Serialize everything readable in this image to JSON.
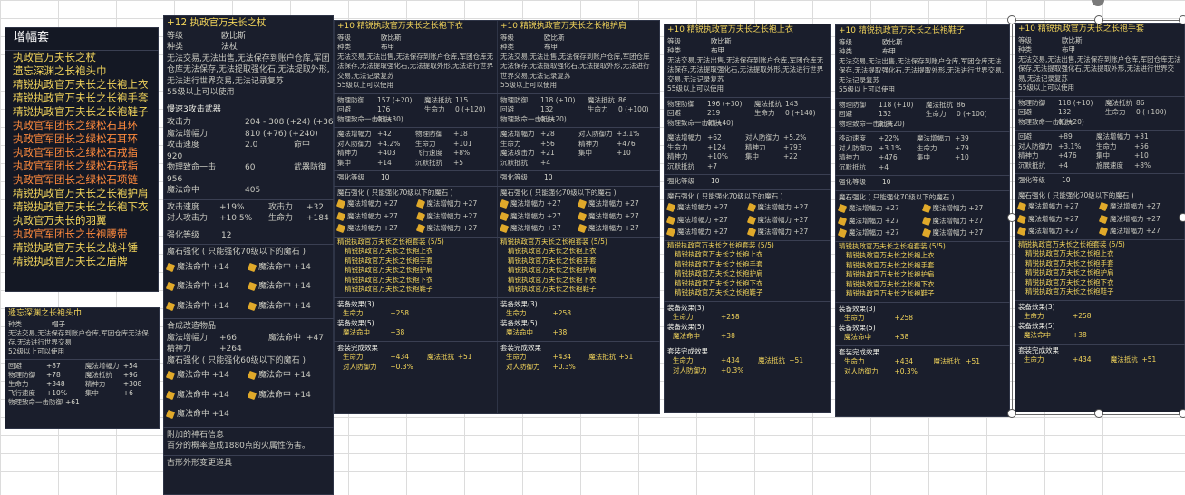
{
  "set_list": {
    "header": "增幅套",
    "items": [
      {
        "t": "执政官万夫长之杖",
        "c": "y"
      },
      {
        "t": "遗忘深渊之长袍头巾",
        "c": "y"
      },
      {
        "t": "精锐执政官万夫长之长袍上衣",
        "c": "y"
      },
      {
        "t": "精锐执政官万夫长之长袍手套",
        "c": "y"
      },
      {
        "t": "精锐执政官万夫长之长袍鞋子",
        "c": "y"
      },
      {
        "t": "执政官军团长之绿松石耳环",
        "c": "o"
      },
      {
        "t": "执政官军团长之绿松石耳环",
        "c": "o"
      },
      {
        "t": "执政官军团长之绿松石戒指",
        "c": "o"
      },
      {
        "t": "执政官军团长之绿松石戒指",
        "c": "o"
      },
      {
        "t": "执政官军团长之绿松石项链",
        "c": "o"
      },
      {
        "t": "精锐执政官万夫长之长袍护肩",
        "c": "y"
      },
      {
        "t": "精锐执政官万夫长之长袍下衣",
        "c": "y"
      },
      {
        "t": "执政官万夫长的羽翼",
        "c": "y"
      },
      {
        "t": "执政官军团长之长袍腰带",
        "c": "o"
      },
      {
        "t": "精锐执政官万夫长之战斗锤",
        "c": "y"
      },
      {
        "t": "精锐执政官万夫长之盾牌",
        "c": "y"
      }
    ]
  },
  "headpiece": {
    "title": "遗忘深渊之长袍头巾",
    "type_label": "种类",
    "type_value": "帽子",
    "desc": "无法交易,无法保存到账户仓库,军团仓库无法保存,无法进行世界交易",
    "level": "52级以上可以使用",
    "stats": [
      [
        "回避",
        "+87",
        "魔法增幅力",
        "+54"
      ],
      [
        "物理防御",
        "+78",
        "魔法抵抗",
        "+96"
      ],
      [
        "生命力",
        "+348",
        "精神力",
        "+308"
      ],
      [
        "飞行速度",
        "+10%",
        "集中",
        "+6"
      ],
      [
        "物理致命一击防御",
        "+61",
        "",
        ""
      ]
    ]
  },
  "staff": {
    "title": "+12 执政官万夫长之杖",
    "grade_label": "等级",
    "grade_value": "欧比斯",
    "type_label": "种类",
    "type_value": "法杖",
    "desc": "无法交易,无法出售,无法保存到账户仓库,军团仓库无法保存,无法提取强化石,无法提取外形,无法进行世界交易,无法记录复苏",
    "level": "55级以上可以使用",
    "weapon_hdr": "慢速3攻击武器",
    "base": [
      [
        "攻击力",
        "204 - 308 (+24) (+36)"
      ],
      [
        "魔法增幅力",
        "810 (+76) (+240)"
      ],
      [
        "攻击速度",
        "2.0",
        "命中",
        "920"
      ],
      [
        "物理致命一击",
        "60",
        "武器防御",
        "956"
      ],
      [
        "魔法命中",
        "405"
      ]
    ],
    "bonus": [
      [
        "攻击速度",
        "+19%",
        "攻击力",
        "+32"
      ],
      [
        "对人攻击力",
        "+10.5%",
        "生命力",
        "+184"
      ]
    ],
    "enh_label": "强化等级",
    "enh_value": "12",
    "gem_hdr1": "魔石强化 ( 只能强化70级以下的魔石 )",
    "gems1": [
      "魔法命中 +14",
      "魔法命中 +14",
      "魔法命中 +14",
      "魔法命中 +14",
      "魔法命中 +14",
      "魔法命中 +14"
    ],
    "combine_hdr": "合成改造物品",
    "combine": [
      [
        "魔法增幅力",
        "+66",
        "魔法命中",
        "+47"
      ],
      [
        "精神力",
        "+264",
        "",
        ""
      ]
    ],
    "gem_hdr2": "魔石强化 ( 只能强化60级以下的魔石 )",
    "gems2": [
      "魔法命中 +14",
      "魔法命中 +14",
      "魔法命中 +14",
      "魔法命中 +14",
      "魔法命中 +14"
    ],
    "extra_hdr": "附加的神石信息",
    "extra": "百分的概率造成1880点的火属性伤害。",
    "footer": "古形外形变更道具"
  },
  "panels": [
    {
      "id": "pants",
      "title": "+10 精锐执政官万夫长之长袍下衣",
      "grade": "欧比斯",
      "type": "布甲",
      "desc": "无法交易,无法出售,无法保存到账户仓库,军团仓库无法保存,无法提取强化石,无法提取外形,无法进行世界交易,无法记录复苏",
      "level": "55级以上可以使用",
      "base": [
        [
          "物理防御",
          "157 (+20)",
          "魔法抵抗",
          "115"
        ],
        [
          "回避",
          "176",
          "生命力",
          "0 (+120)"
        ],
        [
          "物理致命一击抵抗",
          "0 (+30)",
          "",
          ""
        ]
      ],
      "bonus": [
        [
          "魔法增幅力",
          "+42",
          "物理防御",
          "+18"
        ],
        [
          "对人防御力",
          "+4.2%",
          "生命力",
          "+101"
        ],
        [
          "精神力",
          "+403",
          "飞行速度",
          "+8%"
        ],
        [
          "集中",
          "+14",
          "沉默抵抗",
          "+5"
        ]
      ],
      "enh": "10",
      "gem_hdr": "魔石强化 ( 只能强化70级以下的魔石 )",
      "gems": [
        "魔法增幅力 +27",
        "魔法增幅力 +27",
        "魔法增幅力 +27",
        "魔法增幅力 +27",
        "魔法增幅力 +27",
        "魔法增幅力 +27"
      ],
      "set_hdr": "精锐执政官万夫长之长袍套装 (5/5)",
      "set_items": [
        "精锐执政官万夫长之长袍上衣",
        "精锐执政官万夫长之长袍手套",
        "精锐执政官万夫长之长袍护肩",
        "精锐执政官万夫长之长袍下衣",
        "精锐执政官万夫长之长袍鞋子"
      ],
      "effects": [
        {
          "h": "装备效果(3)",
          "rows": [
            [
              "生命力",
              "+258",
              "",
              ""
            ]
          ]
        },
        {
          "h": "装备效果(5)",
          "rows": [
            [
              "魔法命中",
              "+38",
              "",
              ""
            ]
          ]
        },
        {
          "h": "套装完成效果",
          "rows": [
            [
              "生命力",
              "+434",
              "魔法抵抗",
              "+51"
            ],
            [
              "对人防御力",
              "+0.3%",
              "",
              ""
            ]
          ]
        }
      ]
    },
    {
      "id": "shoulder",
      "title": "+10 精锐执政官万夫长之长袍护肩",
      "grade": "欧比斯",
      "type": "布甲",
      "desc": "无法交易,无法出售,无法保存到账户仓库,军团仓库无法保存,无法提取强化石,无法提取外形,无法进行世界交易,无法记录复苏",
      "level": "55级以上可以使用",
      "base": [
        [
          "物理防御",
          "118 (+10)",
          "魔法抵抗",
          "86"
        ],
        [
          "回避",
          "132",
          "生命力",
          "0 (+100)"
        ],
        [
          "物理致命一击抵抗",
          "0 (+20)",
          "",
          ""
        ]
      ],
      "bonus": [
        [
          "魔法增幅力",
          "+28",
          "对人防御力",
          "+3.1%"
        ],
        [
          "生命力",
          "+56",
          "精神力",
          "+476"
        ],
        [
          "魔法攻击力",
          "+21",
          "集中",
          "+10"
        ],
        [
          "沉默抵抗",
          "+4",
          "",
          ""
        ]
      ],
      "enh": "10",
      "gem_hdr": "魔石强化 ( 只能强化70级以下的魔石 )",
      "gems": [
        "魔法增幅力 +27",
        "魔法增幅力 +27",
        "魔法增幅力 +27",
        "魔法增幅力 +27",
        "魔法增幅力 +27",
        "魔法增幅力 +27"
      ],
      "set_hdr": "精锐执政官万夫长之长袍套装 (5/5)",
      "set_items": [
        "精锐执政官万夫长之长袍上衣",
        "精锐执政官万夫长之长袍手套",
        "精锐执政官万夫长之长袍护肩",
        "精锐执政官万夫长之长袍下衣",
        "精锐执政官万夫长之长袍鞋子"
      ],
      "effects": [
        {
          "h": "装备效果(3)",
          "rows": [
            [
              "生命力",
              "+258",
              "",
              ""
            ]
          ]
        },
        {
          "h": "装备效果(5)",
          "rows": [
            [
              "魔法命中",
              "+38",
              "",
              ""
            ]
          ]
        },
        {
          "h": "套装完成效果",
          "rows": [
            [
              "生命力",
              "+434",
              "魔法抵抗",
              "+51"
            ],
            [
              "对人防御力",
              "+0.3%",
              "",
              ""
            ]
          ]
        }
      ]
    },
    {
      "id": "top",
      "title": "+10 精锐执政官万夫长之长袍上衣",
      "grade": "欧比斯",
      "type": "布甲",
      "desc": "无法交易,无法出售,无法保存到账户仓库,军团仓库无法保存,无法提取强化石,无法提取外形,无法进行世界交易,无法记录复苏",
      "level": "55级以上可以使用",
      "base": [
        [
          "物理防御",
          "196 (+30)",
          "魔法抵抗",
          "143"
        ],
        [
          "回避",
          "219",
          "生命力",
          "0 (+140)"
        ],
        [
          "物理致命一击抵抗",
          "0 (+40)",
          "",
          ""
        ]
      ],
      "bonus": [
        [
          "魔法增幅力",
          "+62",
          "对人防御力",
          "+5.2%"
        ],
        [
          "生命力",
          "+124",
          "精神力",
          "+793"
        ],
        [
          "精神力",
          "+10%",
          "集中",
          "+22"
        ],
        [
          "沉默抵抗",
          "+7",
          "",
          ""
        ]
      ],
      "enh": "10",
      "gem_hdr": "魔石强化 ( 只能强化70级以下的魔石 )",
      "gems": [
        "魔法增幅力 +27",
        "魔法增幅力 +27",
        "魔法增幅力 +27",
        "魔法增幅力 +27",
        "魔法增幅力 +27",
        "魔法增幅力 +27"
      ],
      "set_hdr": "精锐执政官万夫长之长袍套装 (5/5)",
      "set_items": [
        "精锐执政官万夫长之长袍上衣",
        "精锐执政官万夫长之长袍手套",
        "精锐执政官万夫长之长袍护肩",
        "精锐执政官万夫长之长袍下衣",
        "精锐执政官万夫长之长袍鞋子"
      ],
      "effects": [
        {
          "h": "装备效果(3)",
          "rows": [
            [
              "生命力",
              "+258",
              "",
              ""
            ]
          ]
        },
        {
          "h": "装备效果(5)",
          "rows": [
            [
              "魔法命中",
              "+38",
              "",
              ""
            ]
          ]
        },
        {
          "h": "套装完成效果",
          "rows": [
            [
              "生命力",
              "+434",
              "魔法抵抗",
              "+51"
            ],
            [
              "对人防御力",
              "+0.3%",
              "",
              ""
            ]
          ]
        }
      ]
    },
    {
      "id": "shoes",
      "title": "+10 精锐执政官万夫长之长袍鞋子",
      "grade": "欧比斯",
      "type": "布甲",
      "desc": "无法交易,无法出售,无法保存到账户仓库,军团仓库无法保存,无法提取强化石,无法提取外形,无法进行世界交易,无法记录复苏",
      "level": "55级以上可以使用",
      "base": [
        [
          "物理防御",
          "118 (+10)",
          "魔法抵抗",
          "86"
        ],
        [
          "回避",
          "132",
          "生命力",
          "0 (+100)"
        ],
        [
          "物理致命一击抵抗",
          "0 (+20)",
          "",
          ""
        ]
      ],
      "bonus": [
        [
          "移动速度",
          "+22%",
          "魔法增幅力",
          "+39"
        ],
        [
          "对人防御力",
          "+3.1%",
          "生命力",
          "+79"
        ],
        [
          "精神力",
          "+476",
          "集中",
          "+10"
        ],
        [
          "沉默抵抗",
          "+4",
          "",
          ""
        ]
      ],
      "enh": "10",
      "gem_hdr": "魔石强化 ( 只能强化70级以下的魔石 )",
      "gems": [
        "魔法增幅力 +27",
        "魔法增幅力 +27",
        "魔法增幅力 +27",
        "魔法增幅力 +27",
        "魔法增幅力 +27",
        "魔法增幅力 +27"
      ],
      "set_hdr": "精锐执政官万夫长之长袍套装 (5/5)",
      "set_items": [
        "精锐执政官万夫长之长袍上衣",
        "精锐执政官万夫长之长袍手套",
        "精锐执政官万夫长之长袍护肩",
        "精锐执政官万夫长之长袍下衣",
        "精锐执政官万夫长之长袍鞋子"
      ],
      "effects": [
        {
          "h": "装备效果(3)",
          "rows": [
            [
              "生命力",
              "+258",
              "",
              ""
            ]
          ]
        },
        {
          "h": "装备效果(5)",
          "rows": [
            [
              "魔法命中",
              "+38",
              "",
              ""
            ]
          ]
        },
        {
          "h": "套装完成效果",
          "rows": [
            [
              "生命力",
              "+434",
              "魔法抵抗",
              "+51"
            ],
            [
              "对人防御力",
              "+0.3%",
              "",
              ""
            ]
          ]
        }
      ]
    },
    {
      "id": "gloves",
      "title": "+10 精锐执政官万夫长之长袍手套",
      "grade": "欧比斯",
      "type": "布甲",
      "desc": "无法交易,无法出售,无法保存到账户仓库,军团仓库无法保存,无法提取强化石,无法提取外形,无法进行世界交易,无法记录复苏",
      "level": "55级以上可以使用",
      "base": [
        [
          "物理防御",
          "118 (+10)",
          "魔法抵抗",
          "86"
        ],
        [
          "回避",
          "132",
          "生命力",
          "0 (+100)"
        ],
        [
          "物理致命一击抵抗",
          "0 (+20)",
          "",
          ""
        ]
      ],
      "bonus": [
        [
          "回避",
          "+89",
          "魔法增幅力",
          "+31"
        ],
        [
          "对人防御力",
          "+3.1%",
          "生命力",
          "+56"
        ],
        [
          "精神力",
          "+476",
          "集中",
          "+10"
        ],
        [
          "沉默抵抗",
          "+4",
          "施展速度",
          "+8%"
        ]
      ],
      "enh": "10",
      "gem_hdr": "魔石强化 ( 只能强化70级以下的魔石 )",
      "gems": [
        "魔法增幅力 +27",
        "魔法增幅力 +27",
        "魔法增幅力 +27",
        "魔法增幅力 +27",
        "魔法增幅力 +27",
        "魔法增幅力 +27"
      ],
      "set_hdr": "精锐执政官万夫长之长袍套装 (5/5)",
      "set_items": [
        "精锐执政官万夫长之长袍上衣",
        "精锐执政官万夫长之长袍手套",
        "精锐执政官万夫长之长袍护肩",
        "精锐执政官万夫长之长袍下衣",
        "精锐执政官万夫长之长袍鞋子"
      ],
      "effects": [
        {
          "h": "装备效果(3)",
          "rows": [
            [
              "生命力",
              "+258",
              "",
              ""
            ]
          ]
        },
        {
          "h": "装备效果(5)",
          "rows": [
            [
              "魔法命中",
              "+38",
              "",
              ""
            ]
          ]
        },
        {
          "h": "套装完成效果",
          "rows": [
            [
              "生命力",
              "+434",
              "魔法抵抗",
              "+51"
            ]
          ]
        }
      ]
    }
  ],
  "labels": {
    "grade": "等级",
    "type": "种类",
    "enh": "强化等级"
  }
}
